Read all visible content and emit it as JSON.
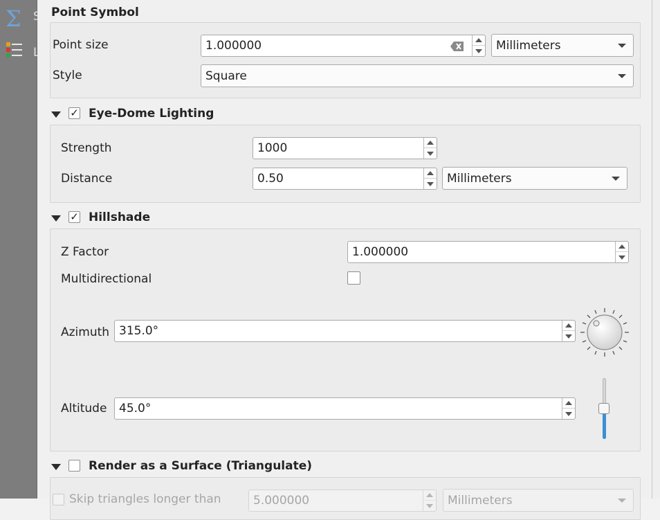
{
  "sidebar": {
    "sigma_icon": "sigma-icon",
    "layers_icon": "layers-icon",
    "label_s": "S",
    "label_l": "L"
  },
  "point_symbol": {
    "title": "Point Symbol",
    "point_size_label": "Point size",
    "point_size_value": "1.000000",
    "point_size_unit": "Millimeters",
    "style_label": "Style",
    "style_value": "Square"
  },
  "edl": {
    "title": "Eye-Dome Lighting",
    "checked": "✓",
    "strength_label": "Strength",
    "strength_value": "1000",
    "distance_label": "Distance",
    "distance_value": "0.50",
    "distance_unit": "Millimeters"
  },
  "hillshade": {
    "title": "Hillshade",
    "checked": "✓",
    "zfactor_label": "Z Factor",
    "zfactor_value": "1.000000",
    "multidirectional_label": "Multidirectional",
    "azimuth_label": "Azimuth",
    "azimuth_value": "315.0°",
    "altitude_label": "Altitude",
    "altitude_value": "45.0°",
    "altitude_level": 0.5
  },
  "surface": {
    "title": "Render as a Surface (Triangulate)",
    "skip_label": "Skip triangles longer than",
    "skip_value": "5.000000",
    "skip_unit": "Millimeters"
  }
}
